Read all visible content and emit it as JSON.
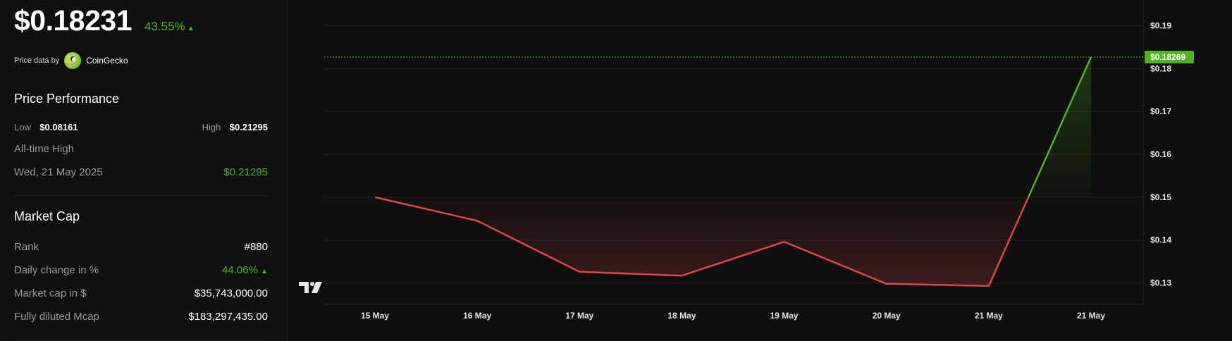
{
  "summary": {
    "price": "$0.18231",
    "change_pct": "43.55%",
    "change_arrow": "▲",
    "source_prefix": "Price data by",
    "source_name": "CoinGecko"
  },
  "performance": {
    "title": "Price Performance",
    "low_label": "Low",
    "low_value": "$0.08161",
    "high_label": "High",
    "high_value": "$0.21295",
    "ath_label": "All-time High",
    "ath_date": "Wed, 21 May 2025",
    "ath_value": "$0.21295"
  },
  "market_cap": {
    "title": "Market Cap",
    "rank_label": "Rank",
    "rank_value": "#880",
    "daily_change_label": "Daily change in %",
    "daily_change_value": "44.06%",
    "daily_change_arrow": "▲",
    "mcap_label": "Market cap in $",
    "mcap_value": "$35,743,000.00",
    "fdv_label": "Fully diluted Mcap",
    "fdv_value": "$183,297,435.00"
  },
  "colors": {
    "up": "#4fb320",
    "down": "#e04545",
    "background": "#0f0f0f"
  },
  "chart_data": {
    "type": "line",
    "x_labels": [
      "15 May",
      "16 May",
      "17 May",
      "18 May",
      "19 May",
      "20 May",
      "21 May",
      "21 May"
    ],
    "values": [
      0.15,
      0.1445,
      0.1326,
      0.1317,
      0.1396,
      0.1298,
      0.1293,
      0.18269
    ],
    "baseline": 0.15,
    "ylim": [
      0.125,
      0.196
    ],
    "y_ticks": [
      0.13,
      0.14,
      0.15,
      0.16,
      0.17,
      0.18,
      0.19
    ],
    "y_tick_labels": [
      "$0.13",
      "$0.14",
      "$0.15",
      "$0.16",
      "$0.17",
      "$0.18",
      "$0.19"
    ],
    "last_price": 0.18269,
    "last_price_label": "$0.18269",
    "grid": true,
    "logo": "tradingview-logo"
  }
}
